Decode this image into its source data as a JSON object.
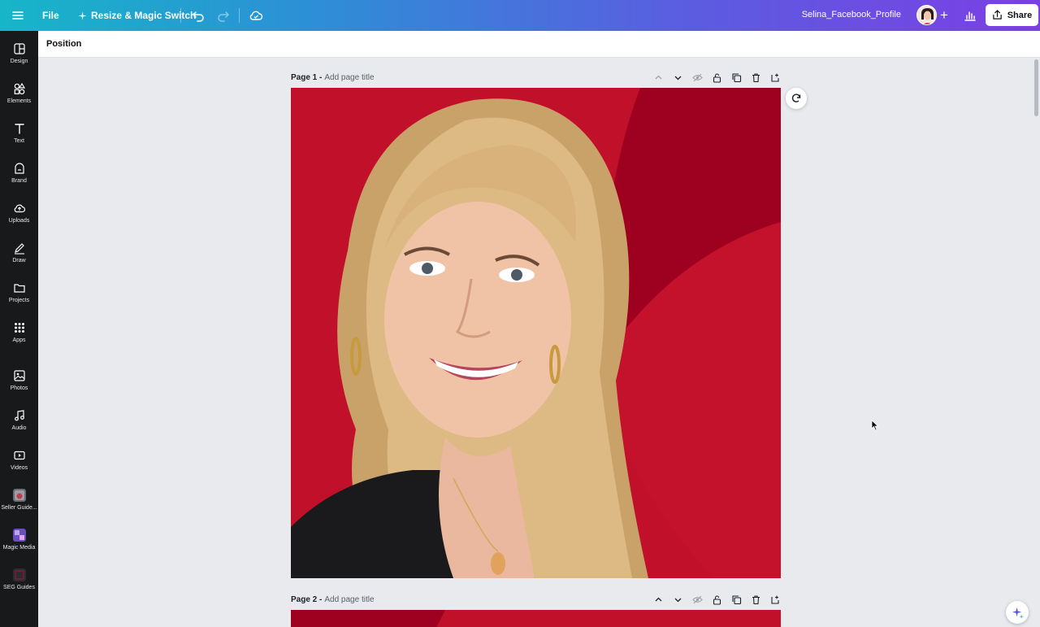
{
  "topbar": {
    "file_label": "File",
    "resize_label": "Resize & Magic Switch",
    "doc_title": "Selina_Facebook_Profile",
    "share_label": "Share"
  },
  "sidebar": {
    "items": [
      {
        "label": "Design",
        "icon": "design-icon"
      },
      {
        "label": "Elements",
        "icon": "elements-icon"
      },
      {
        "label": "Text",
        "icon": "text-icon"
      },
      {
        "label": "Brand",
        "icon": "brand-icon"
      },
      {
        "label": "Uploads",
        "icon": "uploads-icon"
      },
      {
        "label": "Draw",
        "icon": "draw-icon"
      },
      {
        "label": "Projects",
        "icon": "projects-icon"
      },
      {
        "label": "Apps",
        "icon": "apps-icon"
      },
      {
        "label": "Photos",
        "icon": "photos-icon"
      },
      {
        "label": "Audio",
        "icon": "audio-icon"
      },
      {
        "label": "Videos",
        "icon": "videos-icon"
      },
      {
        "label": "Seller Guide...",
        "icon": "seller-guide-app-icon"
      },
      {
        "label": "Magic Media",
        "icon": "magic-media-app-icon"
      },
      {
        "label": "SEG Guides",
        "icon": "seg-guides-app-icon"
      }
    ]
  },
  "context_toolbar": {
    "position_label": "Position"
  },
  "pages": [
    {
      "name": "Page 1 -",
      "title_placeholder": "Add page title"
    },
    {
      "name": "Page 2 -",
      "title_placeholder": "Add page title"
    }
  ],
  "colors": {
    "brand_red": "#c0102a",
    "dark_red": "#9e0020",
    "sidebar_bg": "#18191b"
  }
}
